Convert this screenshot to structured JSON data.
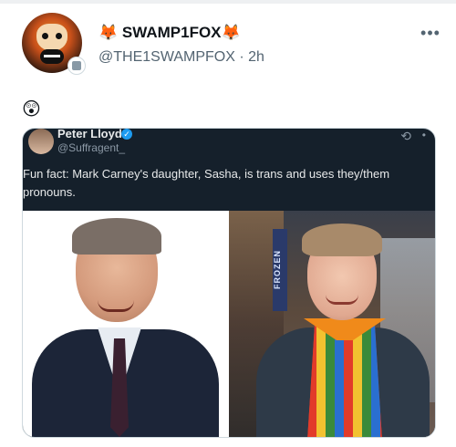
{
  "post": {
    "display_name": "🦊 SWAMP1FOX🦊",
    "handle": "@THE1SWAMPFOX",
    "separator": "·",
    "time": "2h",
    "more_label": "•••",
    "body_emoji": "😲"
  },
  "quoted": {
    "name": "Peter Lloyd",
    "verified_mark": "✓",
    "handle": "@Suffragent_",
    "text": "Fun fact: Mark Carney's daughter, Sasha, is trans and uses they/them pronouns.",
    "icon_left": "⟲",
    "icon_right": "•"
  },
  "photo_right": {
    "sign_text": "FROZEN"
  },
  "icons": {
    "more": "more-horizontal-icon",
    "verified": "verified-check-icon",
    "badge": "affiliate-badge-icon"
  },
  "colors": {
    "text_primary": "#0f1419",
    "text_secondary": "#536471",
    "verified_blue": "#1d9bf0",
    "media_bg": "#15202b"
  }
}
